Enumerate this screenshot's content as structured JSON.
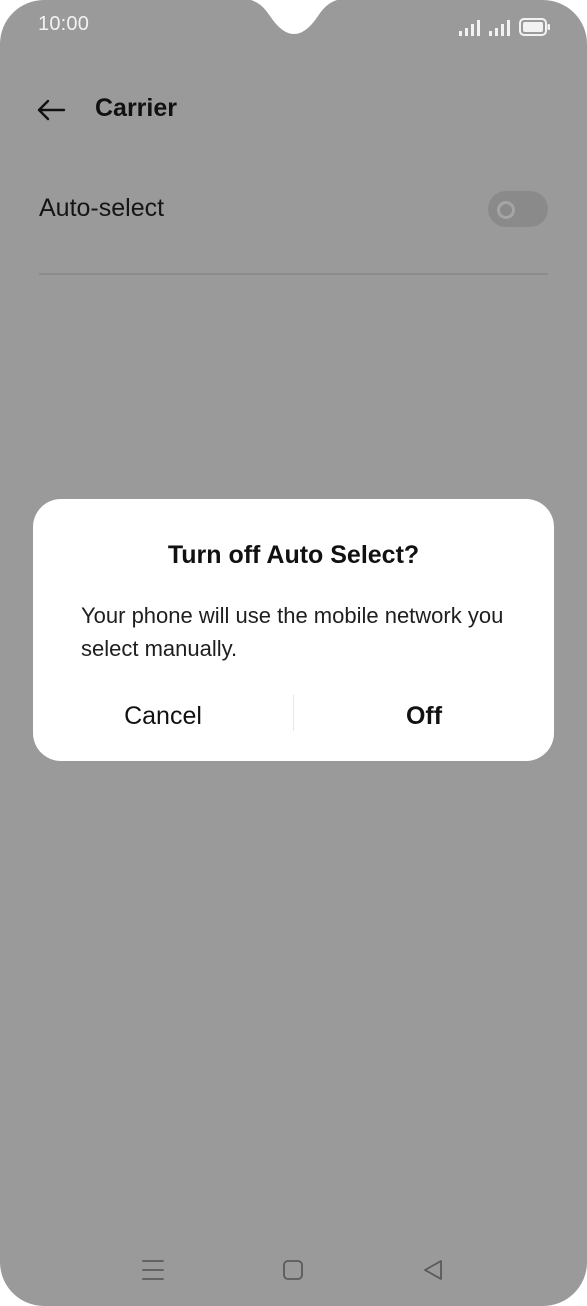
{
  "status_bar": {
    "time": "10:00",
    "icons": [
      "signal-icon",
      "signal-icon",
      "battery-icon"
    ]
  },
  "header": {
    "back_icon": "arrow-left-icon",
    "title": "Carrier"
  },
  "settings": {
    "auto_select": {
      "label": "Auto-select",
      "toggle_state": "off"
    }
  },
  "dialog": {
    "title": "Turn off Auto Select?",
    "message": "Your phone will use the mobile network you select manually.",
    "cancel_label": "Cancel",
    "confirm_label": "Off"
  },
  "nav_bar": {
    "icons": [
      "menu-icon",
      "home-icon",
      "back-icon"
    ]
  },
  "colors": {
    "scrim_background": "#9a9a9a",
    "dialog_background": "#ffffff",
    "text_primary": "#111111"
  }
}
